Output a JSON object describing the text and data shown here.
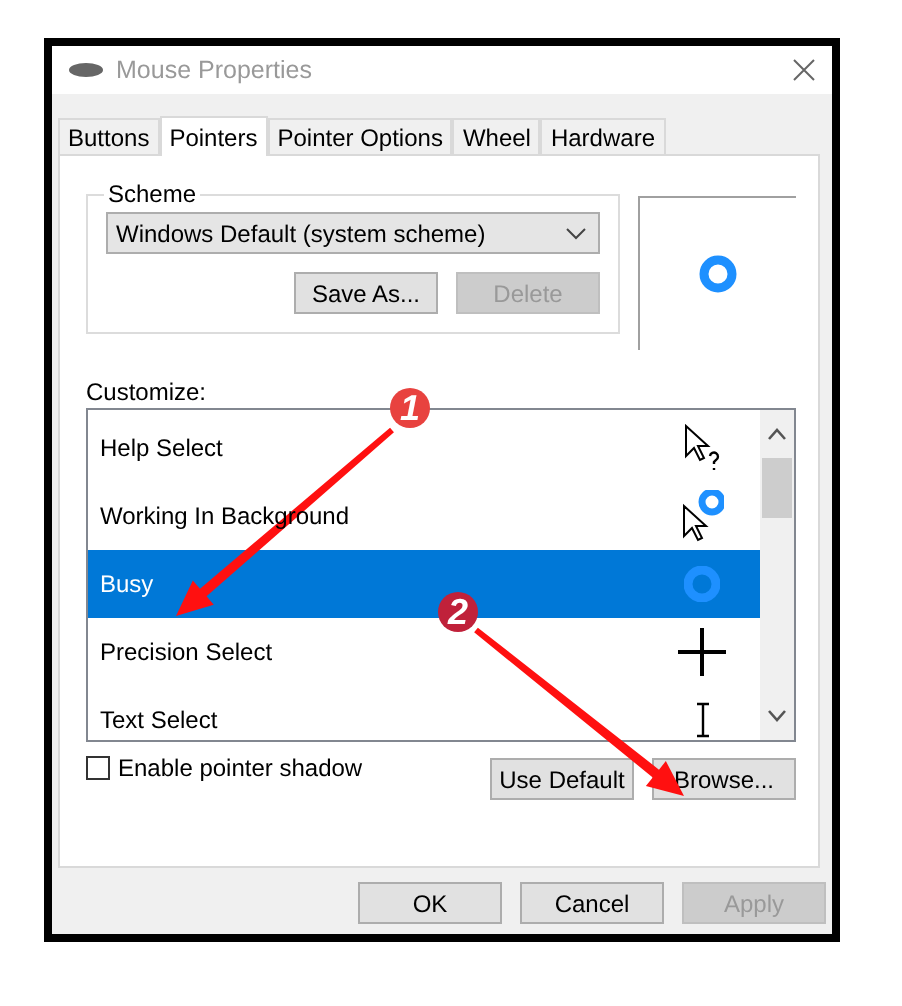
{
  "window": {
    "title": "Mouse Properties"
  },
  "tabs": [
    {
      "label": "Buttons",
      "selected": false
    },
    {
      "label": "Pointers",
      "selected": true
    },
    {
      "label": "Pointer Options",
      "selected": false
    },
    {
      "label": "Wheel",
      "selected": false
    },
    {
      "label": "Hardware",
      "selected": false
    }
  ],
  "scheme": {
    "label": "Scheme",
    "value": "Windows Default (system scheme)",
    "buttons": [
      {
        "label": "Save As...",
        "disabled": false
      },
      {
        "label": "Delete",
        "disabled": true
      }
    ]
  },
  "customize": {
    "label": "Customize:",
    "items": [
      {
        "name": "Help Select",
        "selected": false
      },
      {
        "name": "Working In Background",
        "selected": false
      },
      {
        "name": "Busy",
        "selected": true
      },
      {
        "name": "Precision Select",
        "selected": false
      },
      {
        "name": "Text Select",
        "selected": false
      }
    ]
  },
  "shadow": {
    "label": "Enable pointer shadow",
    "checked": false
  },
  "list_buttons": [
    {
      "label": "Use Default",
      "disabled": false
    },
    {
      "label": "Browse...",
      "disabled": false
    }
  ],
  "buttons": [
    {
      "label": "OK",
      "disabled": false
    },
    {
      "label": "Cancel",
      "disabled": false
    },
    {
      "label": "Apply",
      "disabled": true
    }
  ],
  "annotations": [
    {
      "label": "1"
    },
    {
      "label": "2"
    }
  ]
}
